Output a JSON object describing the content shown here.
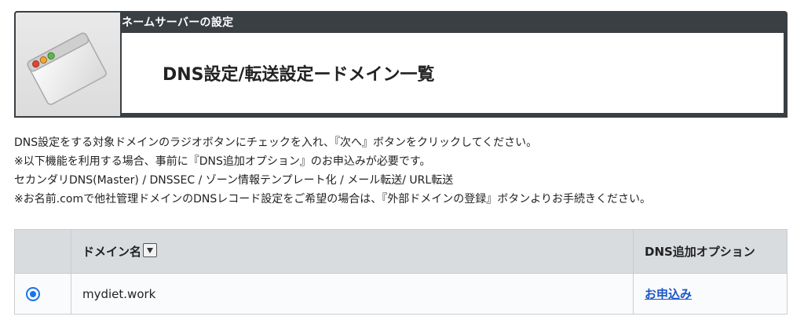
{
  "header": {
    "subtitle": "ネームサーバーの設定",
    "title": "DNS設定/転送設定ードメイン一覧",
    "icon": "browser-window-icon"
  },
  "instructions": [
    "DNS設定をする対象ドメインのラジオボタンにチェックを入れ、『次へ』ボタンをクリックしてください。",
    "※以下機能を利用する場合、事前に『DNS追加オプション』のお申込みが必要です。",
    "セカンダリDNS(Master) / DNSSEC / ゾーン情報テンプレート化 / メール転送/ URL転送",
    "※お名前.comで他社管理ドメインのDNSレコード設定をご希望の場合は、『外部ドメインの登録』ボタンよりお手続きください。"
  ],
  "table": {
    "columns": {
      "domain": "ドメイン名",
      "option": "DNS追加オプション"
    },
    "rows": [
      {
        "selected": true,
        "domain": "mydiet.work",
        "option_link": "お申込み"
      }
    ]
  },
  "colors": {
    "header_bg": "#3a3f44",
    "radio_accent": "#1a73e8",
    "link": "#1a56c8"
  }
}
